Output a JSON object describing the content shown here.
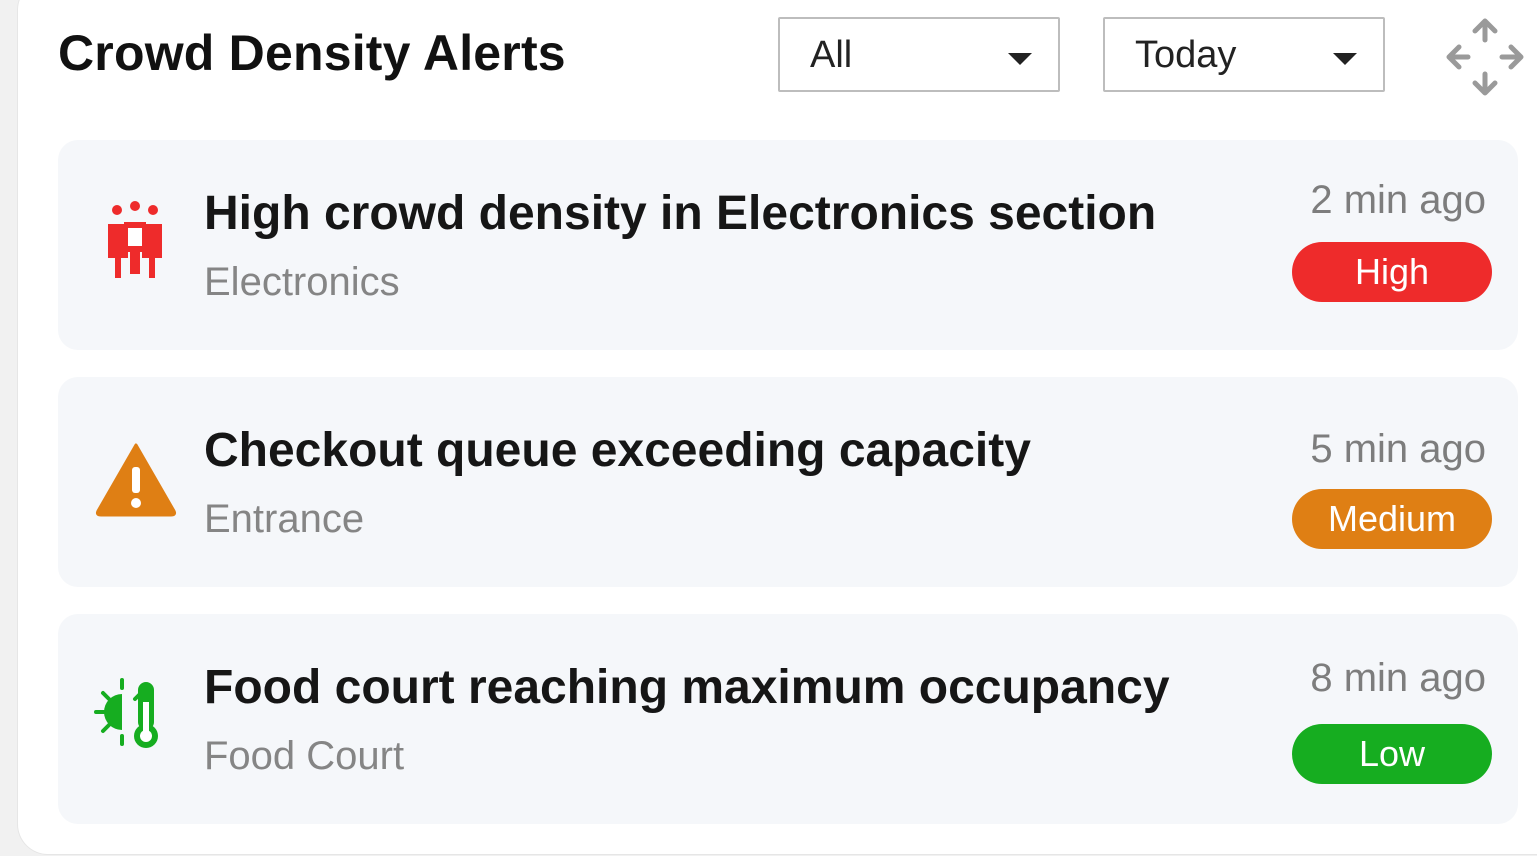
{
  "header": {
    "title": "Crowd Density Alerts",
    "filter_type": {
      "value": "All"
    },
    "filter_period": {
      "value": "Today"
    },
    "drag_icon": "move-arrows-icon"
  },
  "colors": {
    "high": "#ee2b2b",
    "medium": "#df7f14",
    "low": "#16ad20"
  },
  "alerts": [
    {
      "title": "High crowd density in Electronics section",
      "location": "Electronics",
      "time": "2 min ago",
      "severity": "High",
      "icon": "crowd-people-icon"
    },
    {
      "title": "Checkout queue exceeding capacity",
      "location": "Entrance",
      "time": "5 min ago",
      "severity": "Medium",
      "icon": "warning-triangle-icon"
    },
    {
      "title": "Food court reaching maximum occupancy",
      "location": "Food Court",
      "time": "8 min ago",
      "severity": "Low",
      "icon": "temperature-sun-icon"
    }
  ]
}
